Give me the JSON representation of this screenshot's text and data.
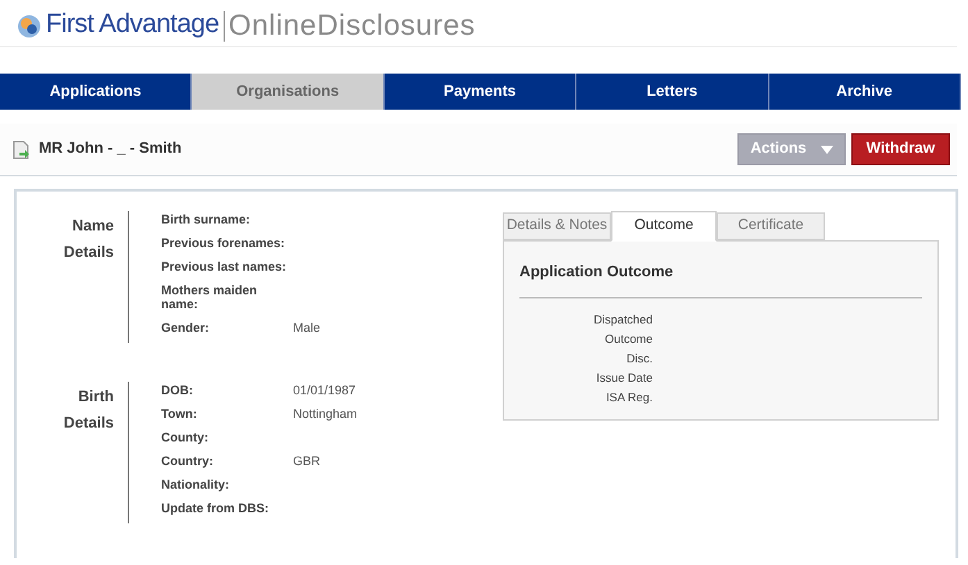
{
  "header": {
    "brand": "First Advantage",
    "product": "OnlineDisclosures"
  },
  "nav": [
    {
      "label": "Applications",
      "selected": false
    },
    {
      "label": "Organisations",
      "selected": true
    },
    {
      "label": "Payments",
      "selected": false
    },
    {
      "label": "Letters",
      "selected": false
    },
    {
      "label": "Archive",
      "selected": false
    }
  ],
  "record": {
    "title": "MR John - _ - Smith",
    "actions": "Actions",
    "withdraw": "Withdraw"
  },
  "sections": [
    {
      "title": [
        "Name",
        "Details"
      ],
      "fields": [
        {
          "label": "Birth surname:"
        },
        {
          "label": "Previous forenames:"
        },
        {
          "label": "Previous last names:"
        },
        {
          "label": "Mothers maiden name:"
        },
        {
          "label": "Gender:",
          "value": "Male"
        }
      ]
    },
    {
      "title": [
        "Birth",
        "Details"
      ],
      "fields": [
        {
          "label": "DOB:",
          "value": "01/01/1987"
        },
        {
          "label": "Town:",
          "value": "Nottingham"
        },
        {
          "label": "County:"
        },
        {
          "label": "Country:",
          "value": "GBR"
        },
        {
          "label": "Nationality:"
        },
        {
          "label": "Update from DBS:"
        }
      ]
    }
  ],
  "detail_tabs": [
    {
      "label": "Details & Notes",
      "selected": false
    },
    {
      "label": "Outcome",
      "selected": true
    },
    {
      "label": "Certificate",
      "selected": false
    }
  ],
  "outcome": {
    "heading": "Application Outcome",
    "labels": [
      "Dispatched",
      "Outcome",
      "Disc.",
      "Issue Date",
      "ISA Reg."
    ]
  }
}
